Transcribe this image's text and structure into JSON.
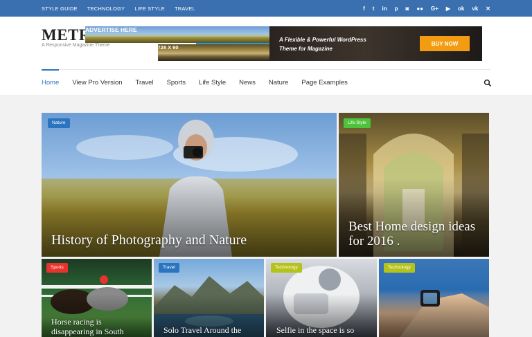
{
  "topbar": {
    "links": [
      "STYLE GUIDE",
      "TECHNOLOGY",
      "LIFE STYLE",
      "TRAVEL"
    ],
    "social_icons": [
      "facebook-icon",
      "twitter-icon",
      "linkedin-icon",
      "pinterest-icon",
      "instagram-icon",
      "flickr-icon",
      "google-plus-icon",
      "youtube-icon",
      "odnoklassniki-icon",
      "vk-icon",
      "xing-icon"
    ],
    "social_glyphs": [
      "f",
      "t",
      "in",
      "p",
      "◙",
      "●●",
      "G+",
      "▶",
      "ok",
      "vk",
      "✕"
    ],
    "color": "#3a6fb0"
  },
  "header": {
    "logo": "METRO",
    "tagline": "A Responsive Magazine Theme"
  },
  "ad": {
    "label": "ADVERTISE HERE",
    "size": "728 X 90",
    "message": "A Flexible & Powerful WordPress Theme for Magazine",
    "button": "BUY NOW",
    "accent": "#1a9fe0",
    "button_color": "#f39c12"
  },
  "nav": {
    "items": [
      "Home",
      "View Pro Version",
      "Travel",
      "Sports",
      "Life Style",
      "News",
      "Nature",
      "Page Examples"
    ],
    "active": "Home",
    "active_color": "#2b74c0"
  },
  "posts": [
    {
      "category": "Nature",
      "title": "History of Photography and Nature",
      "badge_color": "#2b74c0"
    },
    {
      "category": "Life Style",
      "title": "Best Home design ideas for 2016 .",
      "badge_color": "#4cc33b"
    },
    {
      "category": "Sports",
      "title": "Horse racing is disappearing in South",
      "badge_color": "#e8322d"
    },
    {
      "category": "Travel",
      "title": "Solo Travel Around the",
      "badge_color": "#2b74c0"
    },
    {
      "category": "Technology",
      "title": "Selfie in the space is so",
      "badge_color": "#b5c21a"
    },
    {
      "category": "Technology",
      "title": "",
      "badge_color": "#b5c21a"
    }
  ]
}
